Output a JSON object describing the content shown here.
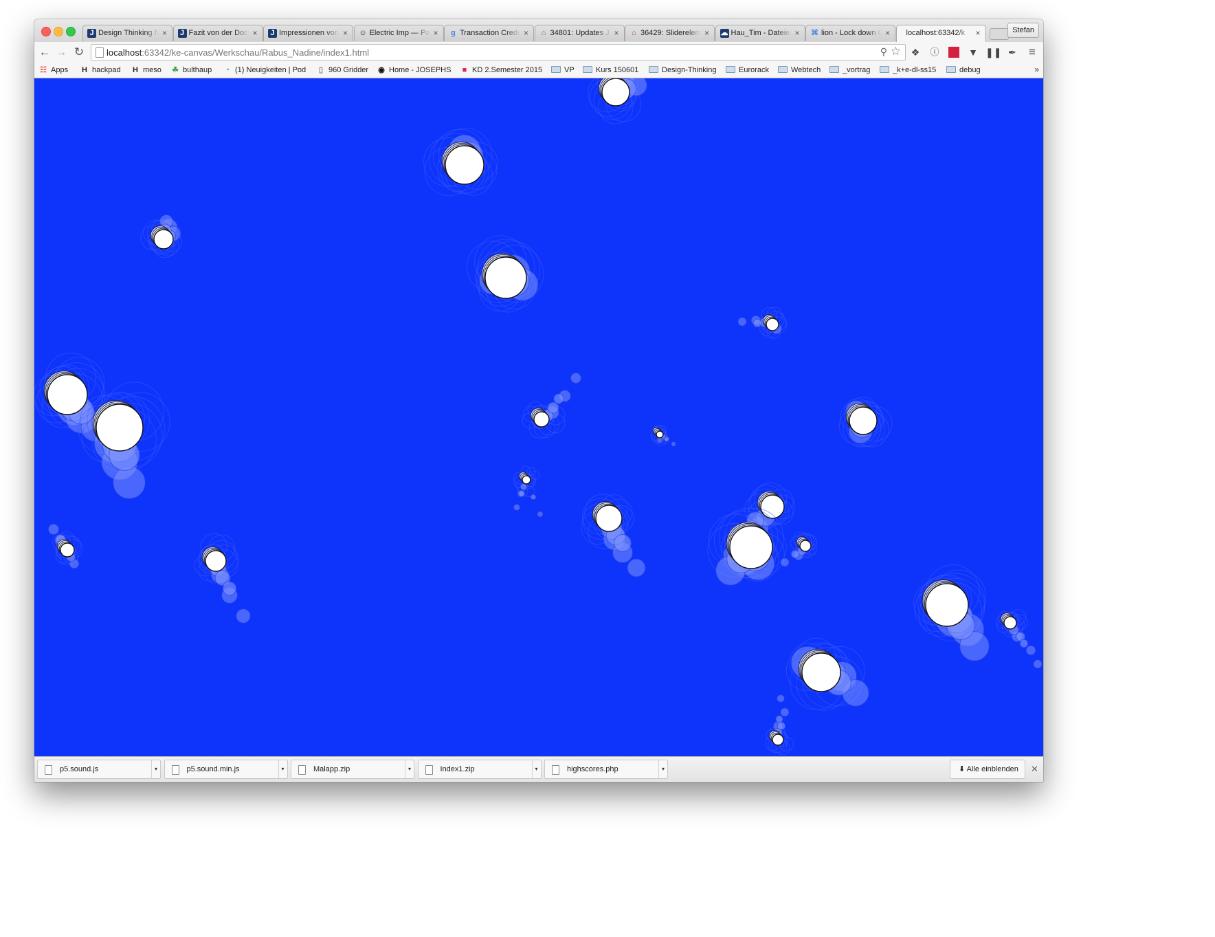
{
  "window": {
    "profile_name": "Stefan",
    "tabs": [
      {
        "title": "Design Thinking fü",
        "favicon": "J",
        "favicon_color": "#1c3a70"
      },
      {
        "title": "Fazit von der Docu",
        "favicon": "J",
        "favicon_color": "#1c3a70"
      },
      {
        "title": "Impressionen von d",
        "favicon": "J",
        "favicon_color": "#1c3a70"
      },
      {
        "title": "Electric Imp — Pa",
        "favicon": "☺",
        "favicon_color": "#222222"
      },
      {
        "title": "Transaction Crede",
        "favicon": "g",
        "favicon_color": "#4a86e8"
      },
      {
        "title": "34801: Updates J",
        "favicon": "⌂",
        "favicon_color": "#a0522d"
      },
      {
        "title": "36429: Sliderelem",
        "favicon": "⌂",
        "favicon_color": "#a0522d"
      },
      {
        "title": "Hau_Tim - Dateien",
        "favicon": "☁",
        "favicon_color": "#1c3a70"
      },
      {
        "title": "lion - Lock down C",
        "favicon": "⌘",
        "favicon_color": "#4a86e8"
      },
      {
        "title": "localhost:63342/k",
        "favicon": "",
        "favicon_color": "#ffffff",
        "active": true
      }
    ]
  },
  "toolbar": {
    "back_icon": "arrow-left-icon",
    "forward_icon": "arrow-right-icon",
    "reload_icon": "reload-icon",
    "url_host": "localhost",
    "url_rest": ":63342/ke-canvas/Werkschau/Rabus_Nadine/index1.html",
    "extensions": [
      "evernote-icon",
      "info-icon",
      "red-ext-icon",
      "pocket-icon",
      "panel-icon",
      "eyedropper-icon",
      "menu-icon"
    ]
  },
  "bookmarks": [
    {
      "label": "Apps",
      "icon": "apps-grid-icon"
    },
    {
      "label": "hackpad",
      "icon": "H"
    },
    {
      "label": "meso",
      "icon": "H"
    },
    {
      "label": "bulthaup",
      "icon": "leaf"
    },
    {
      "label": "(1) Neuigkeiten | Pod",
      "icon": "pod"
    },
    {
      "label": "960 Gridder",
      "icon": "page"
    },
    {
      "label": "Home - JOSEPHS",
      "icon": "circle"
    },
    {
      "label": "KD 2.Semester 2015",
      "icon": "kd"
    },
    {
      "label": "VP",
      "icon": "folder"
    },
    {
      "label": "Kurs 150601",
      "icon": "folder"
    },
    {
      "label": "Design-Thinking",
      "icon": "folder"
    },
    {
      "label": "Eurorack",
      "icon": "folder"
    },
    {
      "label": "Webtech",
      "icon": "folder"
    },
    {
      "label": "_vortrag",
      "icon": "folder"
    },
    {
      "label": "_k+e-dl-ss15",
      "icon": "folder"
    },
    {
      "label": "debug",
      "icon": "folder"
    }
  ],
  "bookmarks_more": "»",
  "canvas": {
    "background": "#0e34fc",
    "blob_color": "#7c92ff",
    "bubble_color": "#ffffff"
  },
  "downloads": {
    "items": [
      "p5.sound.js",
      "p5.sound.min.js",
      "Malapp.zip",
      "Index1.zip",
      "highscores.php"
    ],
    "show_all": "Alle einblenden"
  }
}
